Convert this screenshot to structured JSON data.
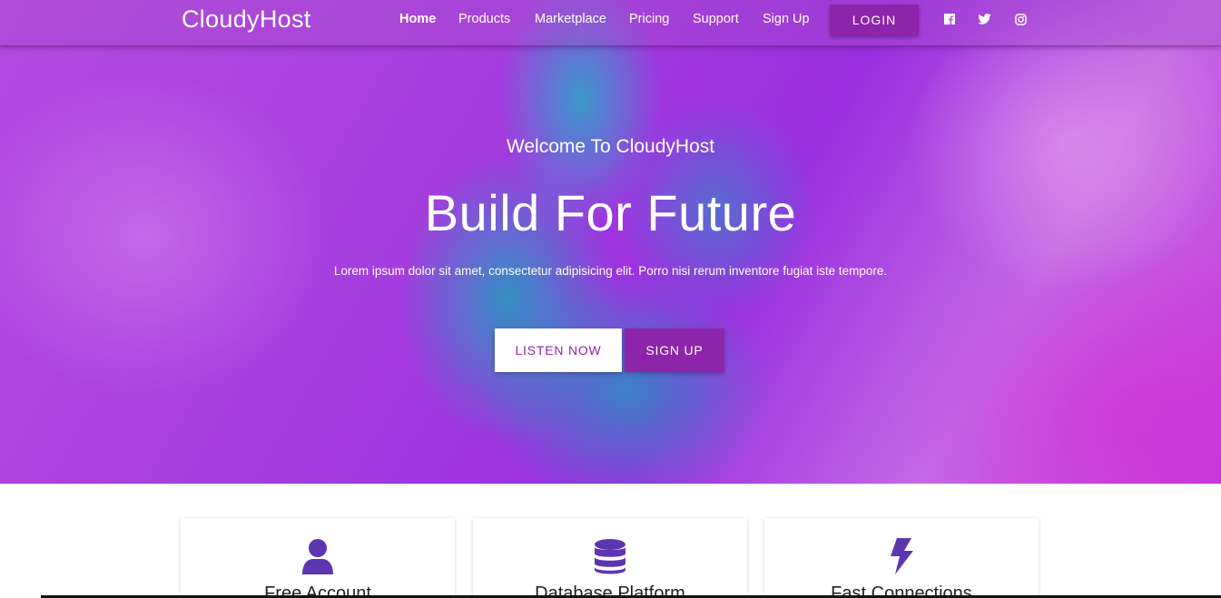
{
  "brand": "CloudyHost",
  "nav": {
    "items": [
      {
        "label": "Home",
        "active": true
      },
      {
        "label": "Products",
        "active": false
      },
      {
        "label": "Marketplace",
        "active": false
      },
      {
        "label": "Pricing",
        "active": false
      },
      {
        "label": "Support",
        "active": false
      },
      {
        "label": "Sign Up",
        "active": false
      }
    ],
    "login_label": "LOGIN",
    "social_icons": [
      "facebook-icon",
      "twitter-icon",
      "instagram-icon"
    ]
  },
  "hero": {
    "subtitle": "Welcome To CloudyHost",
    "title": "Build For Future",
    "text": "Lorem ipsum dolor sit amet, consectetur adipisicing elit. Porro nisi rerum inventore fugiat iste tempore.",
    "listen_label": "LISTEN NOW",
    "signup_label": "SIGN UP"
  },
  "features": [
    {
      "icon": "user-icon",
      "title": "Free Account"
    },
    {
      "icon": "database-icon",
      "title": "Database Platform"
    },
    {
      "icon": "bolt-icon",
      "title": "Fast Connections"
    }
  ],
  "colors": {
    "accent": "#8e24aa",
    "icon": "#5e35b1"
  }
}
